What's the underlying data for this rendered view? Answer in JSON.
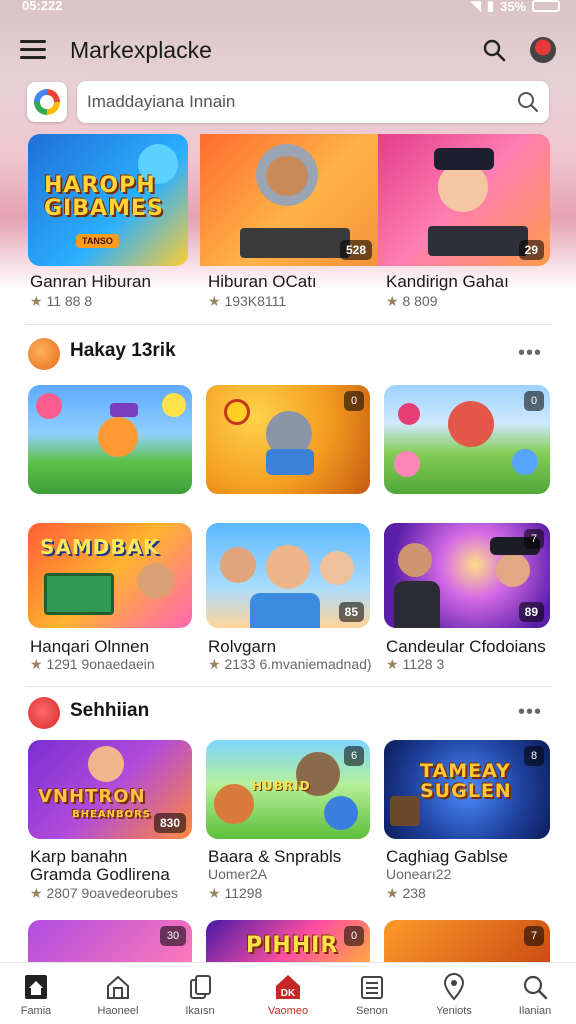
{
  "status": {
    "time": "05:222",
    "battery": "35%"
  },
  "appbar": {
    "title": "Markexplacke"
  },
  "search": {
    "placeholder": "Imaddayiana Innain"
  },
  "featured": [
    {
      "name": "Ganran Hiburan",
      "rating": "11 88 8",
      "art": "HAROPH GIBAMES",
      "sticker": "TANSO"
    },
    {
      "name": "Hiburan OCatı",
      "rating": "193K8111",
      "badge": "528"
    },
    {
      "name": "Kandirign Gahaı",
      "rating": "8 809",
      "badge": "29"
    }
  ],
  "section1": {
    "title": "Hakay 13rik",
    "more": "•••",
    "row1": [
      {
        "badge": ""
      },
      {
        "badge": "0"
      },
      {
        "badge": "0"
      }
    ],
    "row2": [
      {
        "name": "Hanqari Olnnen",
        "rating": "1291 9onaedaein",
        "art": "SAMDBAK"
      },
      {
        "name": "Rolvgarn",
        "rating": "2133 6.mvaniemadnad)",
        "badge": "85"
      },
      {
        "name": "Candeular Cfodoians",
        "rating": "1128 3",
        "badge": "89",
        "badge_top": "7"
      }
    ]
  },
  "section2": {
    "title": "Sehhiian",
    "more": "•••",
    "row": [
      {
        "name": "Karp  banahn",
        "name2": "Gramda Godlirena",
        "rating": "2807 9oavedeorubes",
        "art": "VNHTRON",
        "art2": "BHEANBORS",
        "badge": "830"
      },
      {
        "name": "Baara & Snprabls",
        "sub": "Uomer2A",
        "rating": "11298",
        "art": "HUBRID",
        "badge_top": "6"
      },
      {
        "name": "Caghiag Gablse",
        "sub": "Uonearı22",
        "rating": "238",
        "art": "TAMEAY SUGLEN",
        "badge_top": "8"
      }
    ],
    "partial": [
      {
        "badge": "30"
      },
      {
        "badge": "0",
        "art": "PIHHIR"
      },
      {
        "badge": "7"
      }
    ]
  },
  "nav": [
    {
      "label": "Famia",
      "icon": "home-icon"
    },
    {
      "label": "Haoneel",
      "icon": "house-outline-icon"
    },
    {
      "label": "Ikaısn",
      "icon": "library-icon"
    },
    {
      "label": "Vaomeo",
      "icon": "store-icon"
    },
    {
      "label": "Senon",
      "icon": "list-icon"
    },
    {
      "label": "Yeniots",
      "icon": "location-icon"
    },
    {
      "label": "Ilanian",
      "icon": "search-icon"
    }
  ],
  "colors": {
    "accent": "#c62828",
    "hero_bottom": "#e4a1b6"
  }
}
